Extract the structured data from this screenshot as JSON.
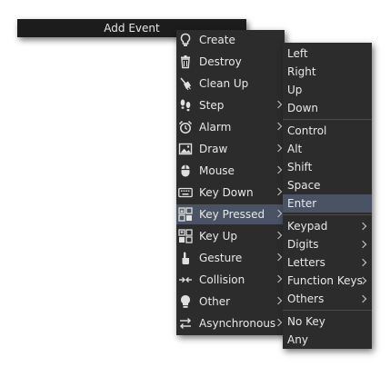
{
  "header": {
    "title": "Add Event"
  },
  "menu": {
    "items": [
      {
        "label": "Create",
        "icon": "bulb-outline-icon",
        "submenu": false
      },
      {
        "label": "Destroy",
        "icon": "trash-icon",
        "submenu": false
      },
      {
        "label": "Clean Up",
        "icon": "broom-icon",
        "submenu": false
      },
      {
        "label": "Step",
        "icon": "footsteps-icon",
        "submenu": true
      },
      {
        "label": "Alarm",
        "icon": "alarm-clock-icon",
        "submenu": true
      },
      {
        "label": "Draw",
        "icon": "image-icon",
        "submenu": true
      },
      {
        "label": "Mouse",
        "icon": "mouse-icon",
        "submenu": true
      },
      {
        "label": "Key Down",
        "icon": "keyboard-icon",
        "submenu": true
      },
      {
        "label": "Key Pressed",
        "icon": "key-pressed-icon",
        "submenu": true,
        "highlighted": true
      },
      {
        "label": "Key Up",
        "icon": "key-up-icon",
        "submenu": true
      },
      {
        "label": "Gesture",
        "icon": "hand-pointer-icon",
        "submenu": true
      },
      {
        "label": "Collision",
        "icon": "collision-arrows-icon",
        "submenu": true
      },
      {
        "label": "Other",
        "icon": "bulb-filled-icon",
        "submenu": true
      },
      {
        "label": "Asynchronous",
        "icon": "swap-arrows-icon",
        "submenu": true
      }
    ]
  },
  "submenu": {
    "groups": [
      [
        {
          "label": "Left"
        },
        {
          "label": "Right"
        },
        {
          "label": "Up"
        },
        {
          "label": "Down"
        }
      ],
      [
        {
          "label": "Control"
        },
        {
          "label": "Alt"
        },
        {
          "label": "Shift"
        },
        {
          "label": "Space"
        },
        {
          "label": "Enter",
          "highlighted": true
        }
      ],
      [
        {
          "label": "Keypad",
          "submenu": true
        },
        {
          "label": "Digits",
          "submenu": true
        },
        {
          "label": "Letters",
          "submenu": true
        },
        {
          "label": "Function Keys",
          "submenu": true
        },
        {
          "label": "Others",
          "submenu": true
        }
      ],
      [
        {
          "label": "No Key"
        },
        {
          "label": "Any"
        }
      ]
    ]
  },
  "colors": {
    "menu_bg": "#2c2c2c",
    "header_bg": "#1c1c1c",
    "highlight": "#4a5364",
    "text": "#e8e8e8"
  }
}
